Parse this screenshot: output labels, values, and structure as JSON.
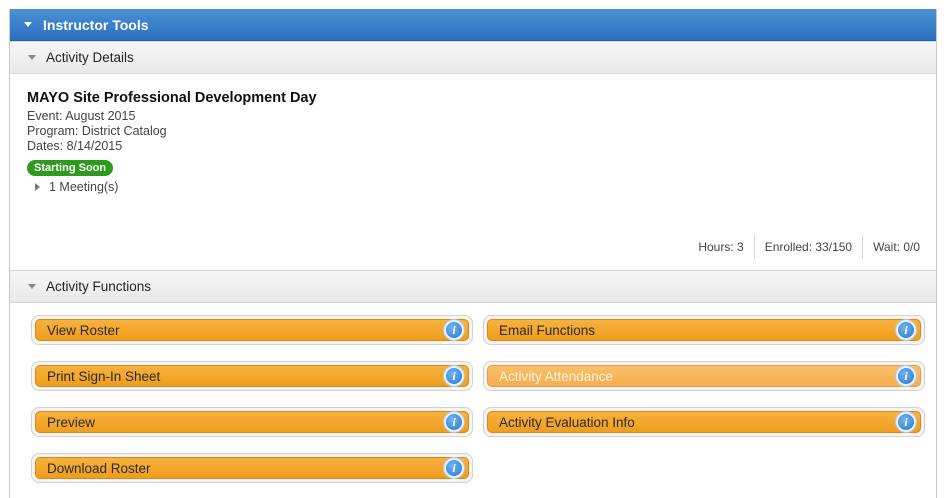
{
  "tools": {
    "title": "Instructor Tools"
  },
  "details": {
    "header": "Activity Details",
    "title": "MAYO Site Professional Development Day",
    "event": "Event: August 2015",
    "program": "Program: District Catalog",
    "dates": "Dates: 8/14/2015",
    "status_badge": "Starting Soon",
    "meetings": "1 Meeting(s)",
    "stats": {
      "hours": "Hours: 3",
      "enrolled": "Enrolled: 33/150",
      "wait": "Wait: 0/0"
    }
  },
  "functions": {
    "header": "Activity Functions",
    "buttons": {
      "view_roster": "View Roster",
      "email_functions": "Email Functions",
      "print_sign_in": "Print Sign-In Sheet",
      "activity_attendance": "Activity Attendance",
      "preview": "Preview",
      "activity_evaluation": "Activity Evaluation Info",
      "download_roster": "Download Roster"
    },
    "info_glyph": "i"
  },
  "colors": {
    "header_blue": "#2a70bf",
    "button_orange": "#f0a020",
    "badge_green": "#2e9a1e",
    "info_blue": "#2a78cf"
  }
}
